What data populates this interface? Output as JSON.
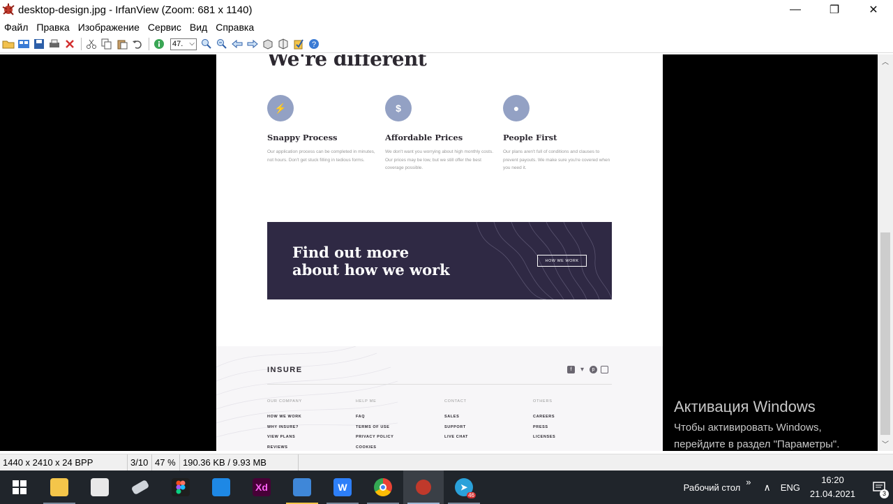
{
  "window": {
    "title": "desktop-design.jpg - IrfanView (Zoom: 681 x 1140)",
    "controls": {
      "minimize": "—",
      "maximize": "❐",
      "close": "✕"
    }
  },
  "menu": [
    "Файл",
    "Правка",
    "Изображение",
    "Сервис",
    "Вид",
    "Справка"
  ],
  "toolbar": {
    "zoom_value": "47.",
    "icons": [
      "open-icon",
      "thumbnails-icon",
      "save-icon",
      "print-icon",
      "delete-icon",
      "cut-icon",
      "copy-icon",
      "paste-icon",
      "undo-icon",
      "info-icon",
      "zoom-in-icon",
      "zoom-out-icon",
      "previous-icon",
      "next-icon",
      "slideshow-icon",
      "settings-icon",
      "edit-icon",
      "help-icon"
    ]
  },
  "image": {
    "heading": "We're different",
    "features": [
      {
        "icon": "⚡",
        "title": "Snappy Process",
        "desc": "Our application process can be completed in minutes, not hours. Don't get stuck filling in tedious forms."
      },
      {
        "icon": "$",
        "title": "Affordable Prices",
        "desc": "We don't want you worrying about high monthly costs. Our prices may be low, but we still offer the best coverage possible."
      },
      {
        "icon": "●",
        "title": "People First",
        "desc": "Our plans aren't full of conditions and clauses to prevent payouts. We make sure you're covered when you need it."
      }
    ],
    "cta": {
      "line1": "Find out more",
      "line2": "about how we work",
      "button": "HOW WE WORK"
    },
    "footer": {
      "logo": "INSURE",
      "columns": [
        {
          "heading": "OUR COMPANY",
          "links": [
            "HOW WE WORK",
            "WHY INSURE?",
            "VIEW PLANS",
            "REVIEWS"
          ]
        },
        {
          "heading": "HELP ME",
          "links": [
            "FAQ",
            "TERMS OF USE",
            "PRIVACY POLICY",
            "COOKIES"
          ]
        },
        {
          "heading": "CONTACT",
          "links": [
            "SALES",
            "SUPPORT",
            "LIVE CHAT"
          ]
        },
        {
          "heading": "OTHERS",
          "links": [
            "CAREERS",
            "PRESS",
            "LICENSES"
          ]
        }
      ]
    }
  },
  "watermark": {
    "title": "Активация Windows",
    "line1": "Чтобы активировать Windows,",
    "line2": "перейдите в раздел \"Параметры\"."
  },
  "status": {
    "dimensions": "1440 x 2410 x 24 BPP",
    "index": "3/10",
    "zoom": "47 %",
    "size": "190.36 KB / 9.93 MB"
  },
  "taskbar": {
    "apps": [
      {
        "name": "file-explorer",
        "glyph": "",
        "color": "#f4c54a"
      },
      {
        "name": "store",
        "glyph": "",
        "color": "#f0f0f0"
      },
      {
        "name": "eraser-app",
        "glyph": "",
        "color": "#cfd4da"
      },
      {
        "name": "figma",
        "glyph": "",
        "color": "#1e1e1e"
      },
      {
        "name": "vscode",
        "glyph": "",
        "color": "#1e88e5"
      },
      {
        "name": "adobe-xd",
        "glyph": "Xd",
        "color": "#470137"
      },
      {
        "name": "file-manager",
        "glyph": "",
        "color": "#3f87d8"
      },
      {
        "name": "wps-writer",
        "glyph": "W",
        "color": "#2d7ff9"
      },
      {
        "name": "chrome",
        "glyph": "",
        "color": "#ffffff"
      },
      {
        "name": "irfanview",
        "glyph": "",
        "color": "#c0392b"
      },
      {
        "name": "telegram",
        "glyph": "",
        "color": "#2aa1da"
      }
    ],
    "telegram_badge": "46",
    "desktop_label": "Рабочий стол",
    "chevron": "»",
    "tray_up": "∧",
    "language": "ENG",
    "time": "16:20",
    "date": "21.04.2021",
    "notifications": "3"
  }
}
